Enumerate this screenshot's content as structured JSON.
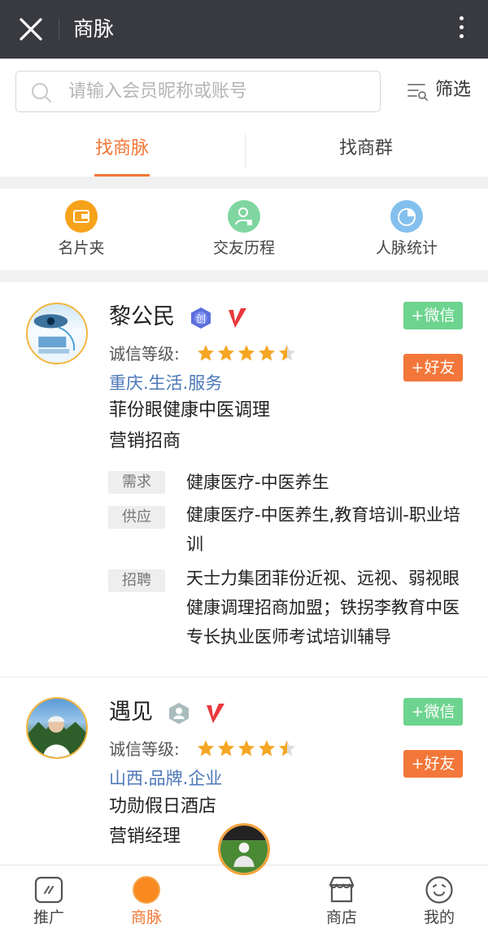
{
  "topbar": {
    "title": "商脉",
    "close_icon": "close-icon",
    "more_icon": "more-vertical-icon"
  },
  "search": {
    "placeholder": "请输入会员昵称或账号",
    "icon": "search-icon"
  },
  "filter": {
    "label": "筛选",
    "icon": "filter-icon"
  },
  "tabs": [
    {
      "label": "找商脉",
      "active": true
    },
    {
      "label": "找商群",
      "active": false
    }
  ],
  "tools": [
    {
      "label": "名片夹",
      "icon": "card-holder-icon",
      "color": "#f7a21b"
    },
    {
      "label": "交友历程",
      "icon": "friend-history-icon",
      "color": "#7fd6a0"
    },
    {
      "label": "人脉统计",
      "icon": "pie-chart-icon",
      "color": "#84c0ee"
    }
  ],
  "members": [
    {
      "name": "黎公民",
      "credit_label": "诚信等级:",
      "rating": 4.5,
      "location": "重庆.生活.服务",
      "company": "菲份眼健康中医调理",
      "position": "营销招商",
      "wechat_btn": "+微信",
      "friend_btn": "+好友",
      "badge": "创",
      "tags": [
        {
          "label": "需求",
          "text": "健康医疗-中医养生"
        },
        {
          "label": "供应",
          "text": "健康医疗-中医养生,教育培训-职业培训"
        },
        {
          "label": "招聘",
          "text": "天士力集团菲份近视、远视、弱视眼健康调理招商加盟；铁拐李教育中医专长执业医师考试培训辅导"
        }
      ]
    },
    {
      "name": "遇见",
      "credit_label": "诚信等级:",
      "rating": 4.5,
      "location": "山西.品牌.企业",
      "company": "功勋假日酒店",
      "position": "营销经理",
      "wechat_btn": "+微信",
      "friend_btn": "+好友"
    }
  ],
  "bottom_nav": [
    {
      "label": "推广",
      "icon": "promote-icon",
      "active": false
    },
    {
      "label": "商脉",
      "icon": "network-icon",
      "active": true
    },
    {
      "label": "",
      "icon": "home-ball-icon",
      "active": false
    },
    {
      "label": "商店",
      "icon": "shop-icon",
      "active": false
    },
    {
      "label": "我的",
      "icon": "me-icon",
      "active": false
    }
  ],
  "colors": {
    "accent": "#f37735",
    "topbar": "#393a3f",
    "wechat": "#6dd48f",
    "friend": "#f3773a",
    "link": "#4d78b8"
  }
}
